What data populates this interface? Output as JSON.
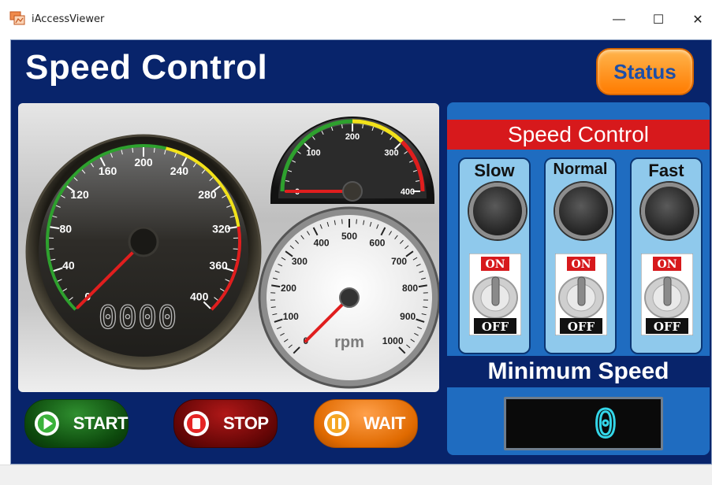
{
  "window": {
    "title": "iAccessViewer",
    "minimize_glyph": "—",
    "maximize_glyph": "☐",
    "close_glyph": "✕"
  },
  "header": {
    "title": "Speed Control",
    "status_button": "Status"
  },
  "speedometer": {
    "ticks": [
      "0",
      "40",
      "80",
      "120",
      "160",
      "200",
      "240",
      "280",
      "320",
      "360",
      "400"
    ],
    "readout": "0000",
    "needle_value": 0,
    "max": 400
  },
  "small_gauge": {
    "ticks": [
      "0",
      "100",
      "200",
      "300",
      "400"
    ],
    "needle_value": 0,
    "max": 400
  },
  "rpm_gauge": {
    "ticks": [
      "0",
      "100",
      "200",
      "300",
      "400",
      "500",
      "600",
      "700",
      "800",
      "900",
      "1000"
    ],
    "unit": "rpm",
    "needle_value": 0,
    "max": 1000
  },
  "speed_panel": {
    "title": "Speed Control",
    "switches": [
      {
        "label": "Slow",
        "on": "ON",
        "off": "OFF"
      },
      {
        "label": "Normal",
        "on": "ON",
        "off": "OFF"
      },
      {
        "label": "Fast",
        "on": "ON",
        "off": "OFF"
      }
    ],
    "min_speed_label": "Minimum Speed",
    "min_speed_value": "0"
  },
  "controls": {
    "start": "START",
    "stop": "STOP",
    "wait": "WAIT"
  },
  "colors": {
    "frame": "#08246b",
    "panel": "#1f6cc0",
    "banner": "#d7191c",
    "accent_orange": "#ff8a00",
    "needle": "#e01e1e",
    "lcd": "#33d6e8"
  }
}
